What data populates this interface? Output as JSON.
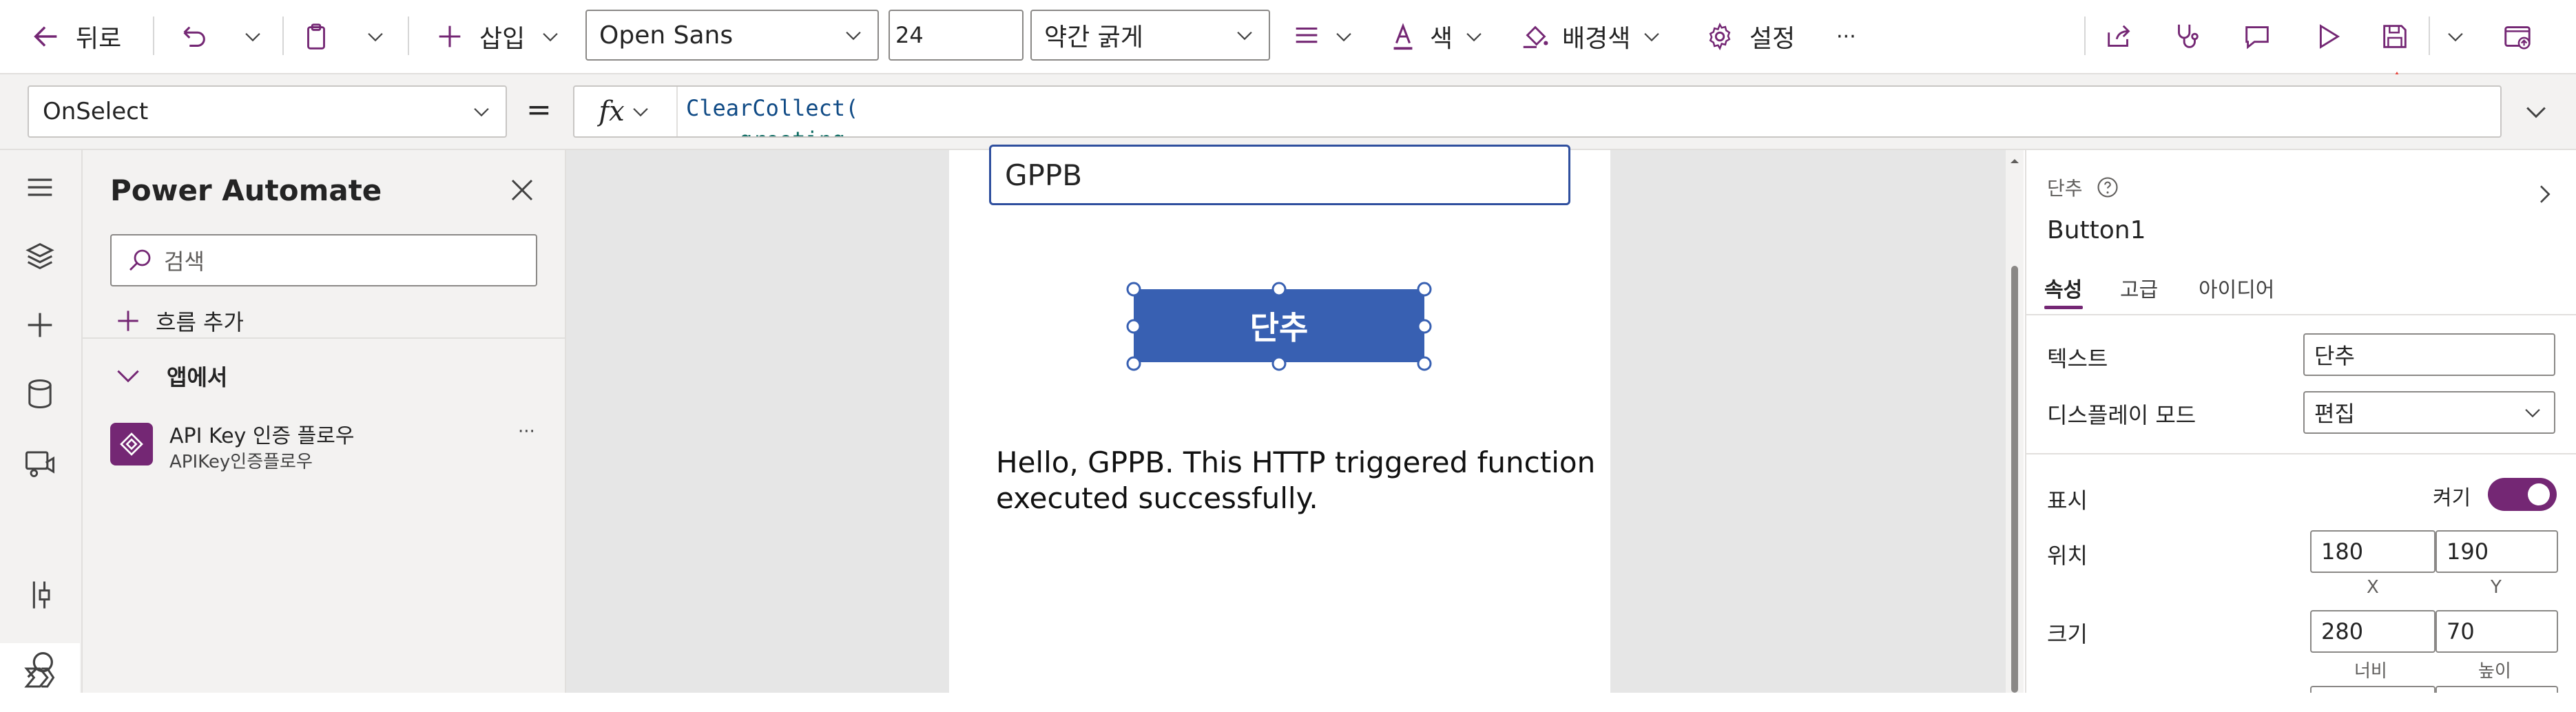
{
  "toolbar": {
    "back_label": "뒤로",
    "insert_label": "삽입",
    "font_family": "Open Sans",
    "font_size": "24",
    "font_weight": "약간 굵게",
    "color_label": "색",
    "fill_label": "배경색",
    "settings_label": "설정",
    "more_label": "···"
  },
  "formula": {
    "property": "OnSelect",
    "equals": "=",
    "fx": "fx",
    "line1": "ClearCollect(",
    "line2": "    greeting,"
  },
  "pane": {
    "title": "Power Automate",
    "search_placeholder": "검색",
    "add_flow_label": "흐름 추가",
    "section_label": "앱에서",
    "flows": [
      {
        "name": "API Key 인증 플로우",
        "sub": "APIKey인증플로우",
        "more": "···"
      }
    ]
  },
  "canvas": {
    "textbox_value": "GPPB",
    "button_label": "단추",
    "result_line1": "Hello, GPPB. This HTTP triggered function",
    "result_line2": "executed successfully."
  },
  "props": {
    "type_label": "단추",
    "control_name": "Button1",
    "tabs": [
      "속성",
      "고급",
      "아이디어"
    ],
    "text_label": "텍스트",
    "text_value": "단추",
    "display_mode_label": "디스플레이 모드",
    "display_mode_value": "편집",
    "visible_label": "표시",
    "visible_state": "켜기",
    "position_label": "위치",
    "x_value": "180",
    "y_value": "190",
    "x_sub": "X",
    "y_sub": "Y",
    "size_label": "크기",
    "width_value": "280",
    "height_value": "70",
    "width_sub": "너비",
    "height_sub": "높이"
  },
  "colors": {
    "accent": "#742774",
    "button_fill": "#3860b2",
    "arrow": "#e8453c"
  }
}
